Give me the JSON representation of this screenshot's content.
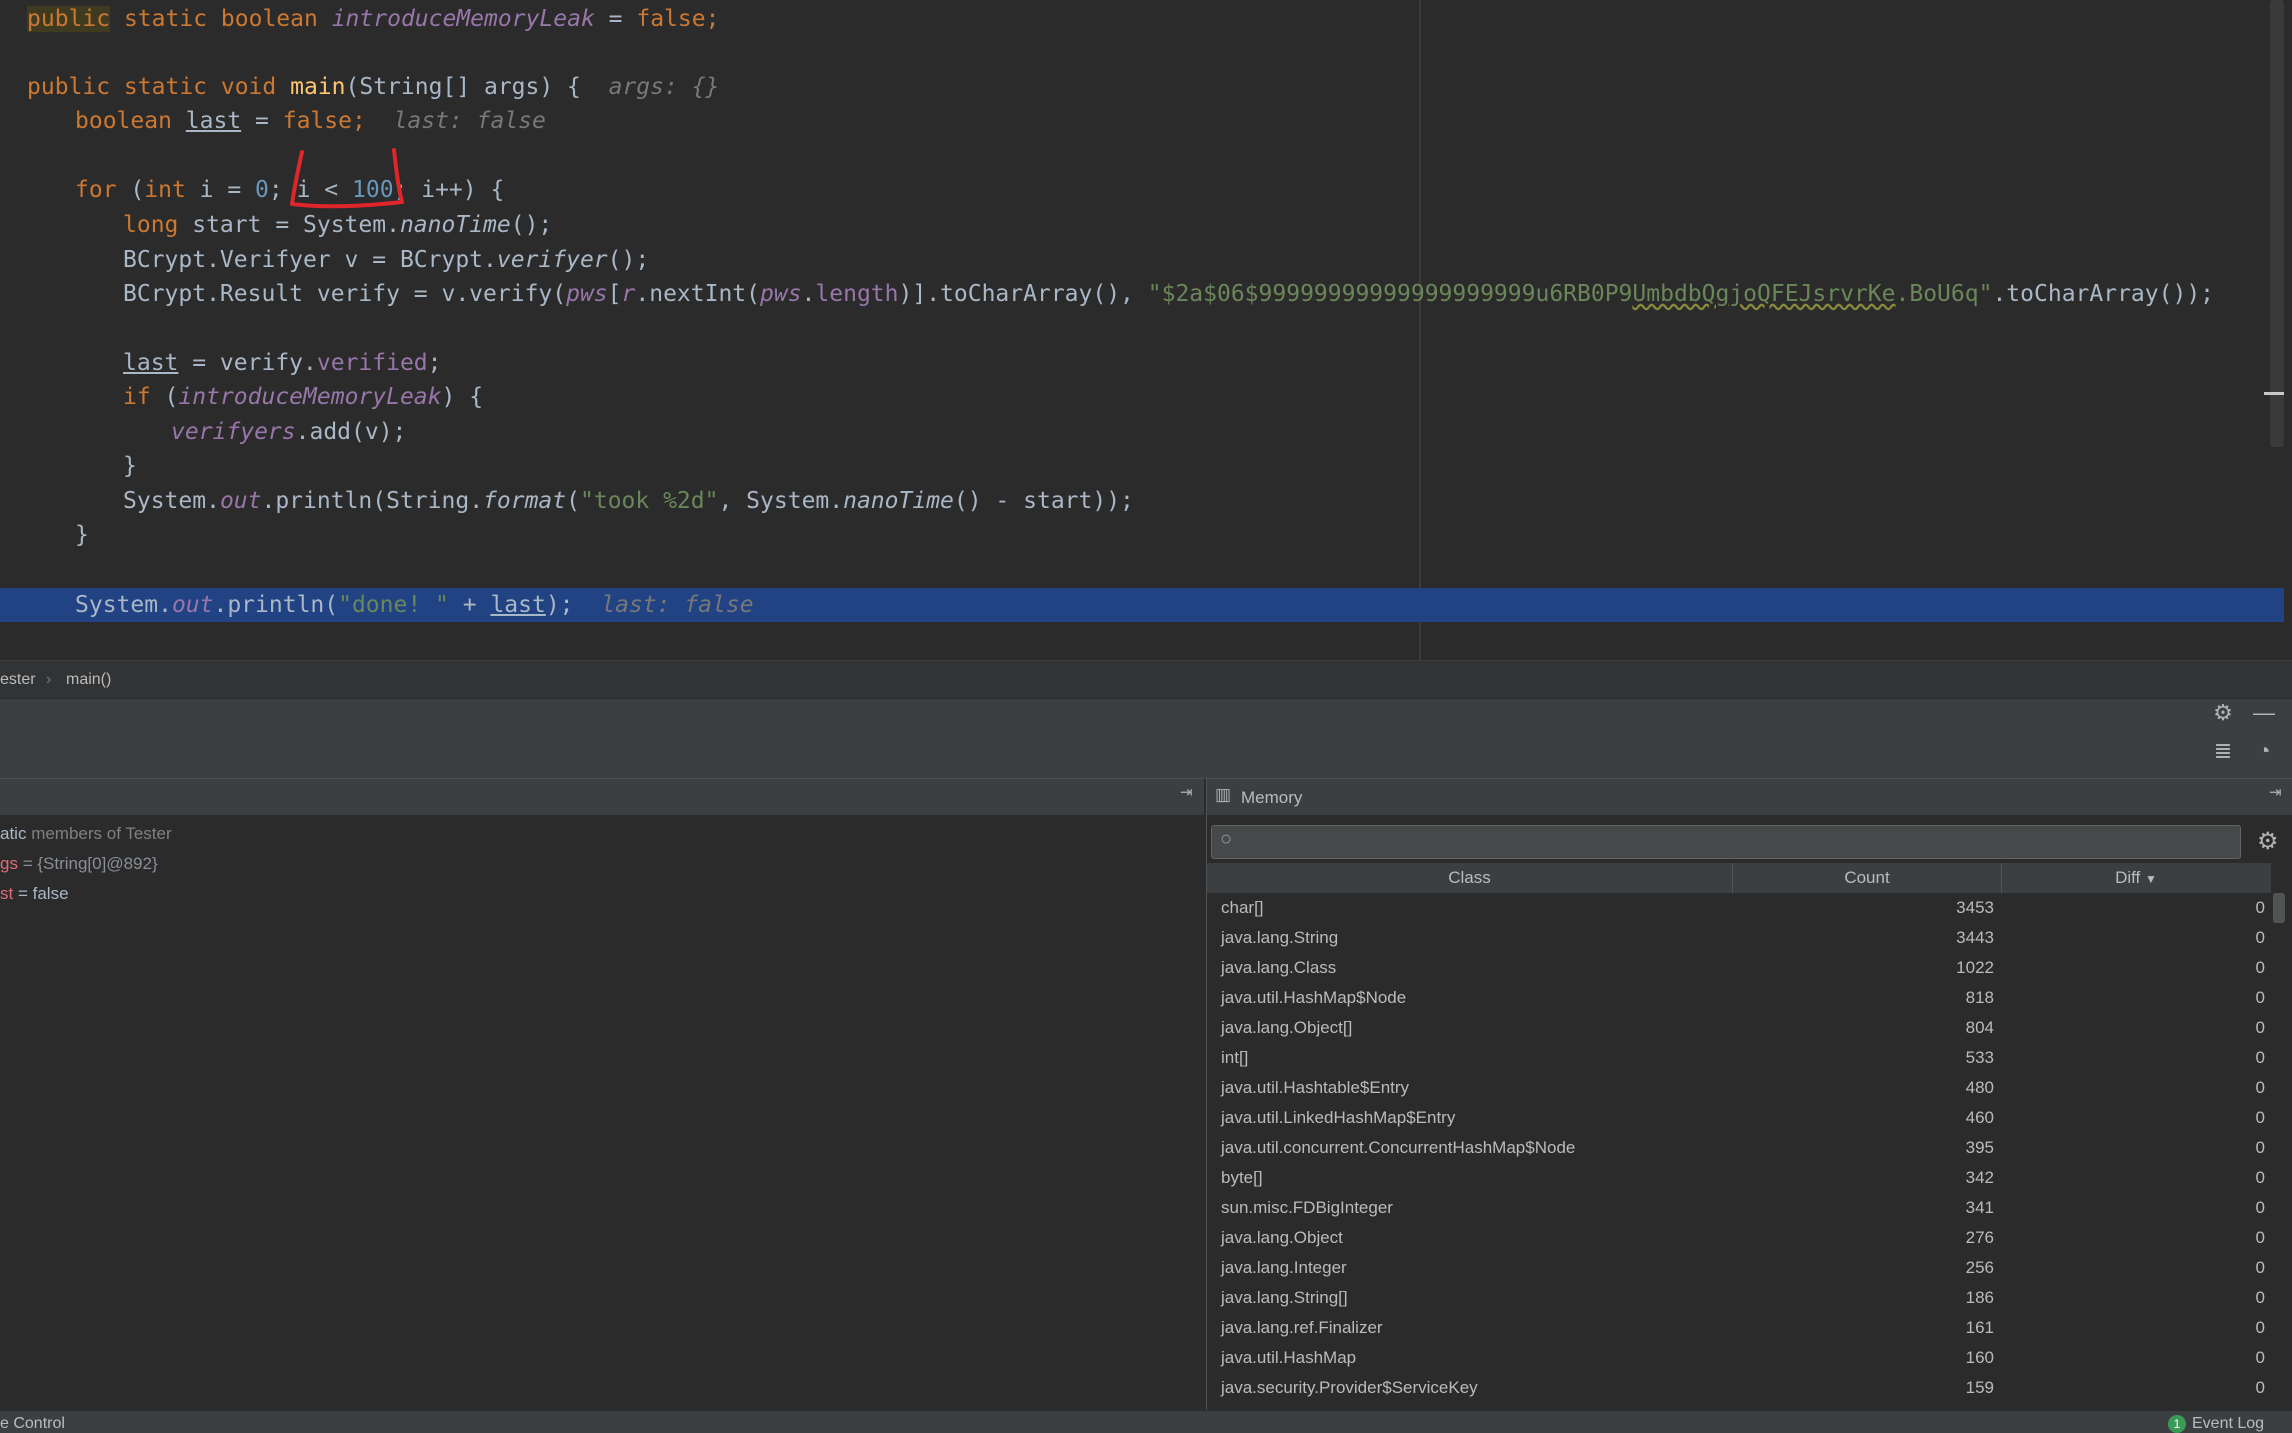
{
  "editor": {
    "lines": {
      "l1": {
        "public": "public",
        "static": "static",
        "boolean": "boolean",
        "field": "introduceMemoryLeak",
        "eq": " = ",
        "val": "false",
        ";": ";"
      },
      "l3": {
        "mods": "public static void ",
        "name": "main",
        "params": "(String[] args) {",
        "hint": "args: {}"
      },
      "l4": {
        "type": "boolean ",
        "var": "last",
        "eq": " = ",
        "val": "false",
        ";": ";",
        "hint": "last: false"
      },
      "l6": {
        "for": "for",
        "open": " (",
        "int": "int",
        "mid1": " i = ",
        "zero": "0",
        "mid2": "; i < ",
        "hundred": "100",
        "mid3": "; i++) {"
      },
      "l7": {
        "long": "long",
        "rest1": " start = System.",
        "call": "nanoTime",
        "rest2": "();"
      },
      "l8": {
        "rest1": "BCrypt.Verifyer v = BCrypt.",
        "call": "verifyer",
        "rest2": "();"
      },
      "l9": {
        "rest1": "BCrypt.Result verify = v.verify(",
        "pws1": "pws",
        "b1": "[",
        "r": "r",
        "rest2": ".nextInt(",
        "pws2": "pws",
        "dot": ".",
        "length": "length",
        "rest3": ")].toCharArray(), ",
        "str_pre": "\"$2a$06$99999999999999999999u6RB0P9",
        "str_sq": "UmbdbQgjoQFEJsrvrKe",
        "str_post": ".BoU6q\"",
        "rest4": ".toCharArray());"
      },
      "l11": {
        "var": "last",
        "rest1": " = verify.",
        "field": "verified",
        "rest2": ";"
      },
      "l12": {
        "if": "if",
        "open": " (",
        "field": "introduceMemoryLeak",
        "close": ") {"
      },
      "l13": {
        "field": "verifyers",
        "rest": ".add(v);"
      },
      "l14": {
        "brace": "}"
      },
      "l15": {
        "rest1": "System.",
        "out": "out",
        "rest2": ".println(String.",
        "format": "format",
        "rest3": "(",
        "str": "\"took %2d\"",
        "rest4": ", System.",
        "nano": "nanoTime",
        "rest5": "() - start));"
      },
      "l16": {
        "brace": "}"
      },
      "l18": {
        "rest1": "System.",
        "out": "out",
        "rest2": ".println(",
        "str": "\"done! \"",
        "rest3": " + ",
        "var": "last",
        "rest4": ");",
        "hint": "last: false"
      }
    }
  },
  "breadcrumb": {
    "class": "ester",
    "sep": "›",
    "method": "main()"
  },
  "variables": {
    "rows": [
      {
        "name": "atic",
        "value": " members of Tester"
      },
      {
        "name": "gs",
        "value": " = {String[0]@892}"
      },
      {
        "name": "st",
        "value": " = false"
      }
    ]
  },
  "memory": {
    "title": "Memory",
    "search_placeholder": "",
    "columns": {
      "class": "Class",
      "count": "Count",
      "diff": "Diff"
    },
    "rows": [
      {
        "class": "char[]",
        "count": "3453",
        "diff": "0"
      },
      {
        "class": "java.lang.String",
        "count": "3443",
        "diff": "0"
      },
      {
        "class": "java.lang.Class",
        "count": "1022",
        "diff": "0"
      },
      {
        "class": "java.util.HashMap$Node",
        "count": "818",
        "diff": "0"
      },
      {
        "class": "java.lang.Object[]",
        "count": "804",
        "diff": "0"
      },
      {
        "class": "int[]",
        "count": "533",
        "diff": "0"
      },
      {
        "class": "java.util.Hashtable$Entry",
        "count": "480",
        "diff": "0"
      },
      {
        "class": "java.util.LinkedHashMap$Entry",
        "count": "460",
        "diff": "0"
      },
      {
        "class": "java.util.concurrent.ConcurrentHashMap$Node",
        "count": "395",
        "diff": "0"
      },
      {
        "class": "byte[]",
        "count": "342",
        "diff": "0"
      },
      {
        "class": "sun.misc.FDBigInteger",
        "count": "341",
        "diff": "0"
      },
      {
        "class": "java.lang.Object",
        "count": "276",
        "diff": "0"
      },
      {
        "class": "java.lang.Integer",
        "count": "256",
        "diff": "0"
      },
      {
        "class": "java.lang.String[]",
        "count": "186",
        "diff": "0"
      },
      {
        "class": "java.lang.ref.Finalizer",
        "count": "161",
        "diff": "0"
      },
      {
        "class": "java.util.HashMap",
        "count": "160",
        "diff": "0"
      },
      {
        "class": "java.security.Provider$ServiceKey",
        "count": "159",
        "diff": "0"
      }
    ]
  },
  "status": {
    "left": "e Control",
    "badge": "1",
    "right": "Event Log"
  },
  "colors": {
    "keyword": "#cc7832",
    "number": "#6897bb",
    "string": "#6a8759",
    "field": "#9876aa",
    "method_decl": "#ffc66d",
    "exec_line": "#214283",
    "annotation": "#e0252b"
  }
}
